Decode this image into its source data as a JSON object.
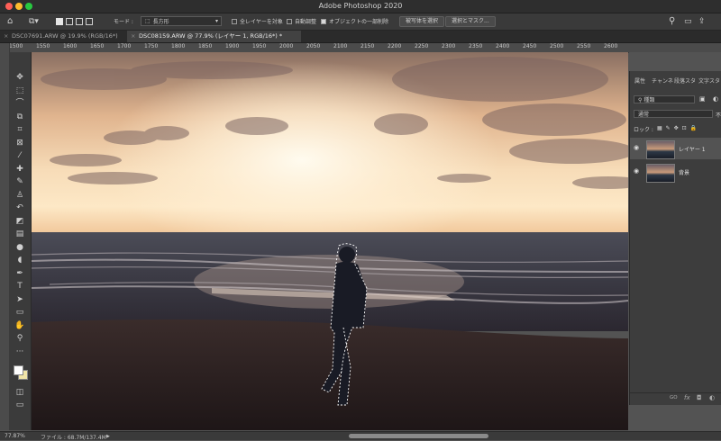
{
  "app": {
    "title": "Adobe Photoshop 2020"
  },
  "options_bar": {
    "mode_label": "モード :",
    "selection_mode": "長方形",
    "sample_all_layers": "全レイヤーを対象",
    "auto_enhance": "自動調整",
    "object_subtract": "オブジェクトの一部削除",
    "select_subject_button": "被写体を選択",
    "select_and_mask_button": "選択とマスク..."
  },
  "tabs": [
    {
      "label": "DSC07691.ARW @ 19.9% (RGB/16*)"
    },
    {
      "label": "DSC08159.ARW @ 77.9% (レイヤー 1, RGB/16*) *"
    }
  ],
  "ruler": {
    "ticks": [
      "1500",
      "1550",
      "1600",
      "1650",
      "1700",
      "1750",
      "1800",
      "1850",
      "1900",
      "1950",
      "2000",
      "2050",
      "2100",
      "2150",
      "2200",
      "2250",
      "2300",
      "2350",
      "2400",
      "2450",
      "2500",
      "2550",
      "2600"
    ]
  },
  "tools": [
    {
      "name": "move-tool",
      "glyph": "✥"
    },
    {
      "name": "marquee-tool",
      "glyph": "⬚"
    },
    {
      "name": "lasso-tool",
      "glyph": "⌒"
    },
    {
      "name": "object-select-tool",
      "glyph": "⧉"
    },
    {
      "name": "crop-tool",
      "glyph": "⌗"
    },
    {
      "name": "frame-tool",
      "glyph": "⊠"
    },
    {
      "name": "eyedropper-tool",
      "glyph": "⁄"
    },
    {
      "name": "healing-brush-tool",
      "glyph": "✚"
    },
    {
      "name": "brush-tool",
      "glyph": "✎"
    },
    {
      "name": "clone-stamp-tool",
      "glyph": "♙"
    },
    {
      "name": "history-brush-tool",
      "glyph": "↶"
    },
    {
      "name": "eraser-tool",
      "glyph": "◩"
    },
    {
      "name": "gradient-tool",
      "glyph": "▤"
    },
    {
      "name": "blur-tool",
      "glyph": "●"
    },
    {
      "name": "dodge-tool",
      "glyph": "◖"
    },
    {
      "name": "pen-tool",
      "glyph": "✒"
    },
    {
      "name": "type-tool",
      "glyph": "T"
    },
    {
      "name": "path-select-tool",
      "glyph": "➤"
    },
    {
      "name": "rectangle-tool",
      "glyph": "▭"
    },
    {
      "name": "hand-tool",
      "glyph": "✋"
    },
    {
      "name": "zoom-tool",
      "glyph": "⚲"
    },
    {
      "name": "more-tools",
      "glyph": "···"
    }
  ],
  "colors": {
    "foreground": "#ffffff",
    "background": "#f0e4a8",
    "accent": "#d8d8d8"
  },
  "layers_panel": {
    "tabs": [
      "属性",
      "チャンネ",
      "段落スタ",
      "文字スタ"
    ],
    "filter_kind": "種類",
    "blend_mode": "通常",
    "opacity_label": "不",
    "lock_label": "ロック :",
    "layers": [
      {
        "name": "レイヤー 1",
        "visible": true,
        "selected": true
      },
      {
        "name": "背景",
        "visible": true,
        "selected": false
      }
    ],
    "footer_icons": [
      "link-icon",
      "fx-icon",
      "mask-icon",
      "adjustment-icon"
    ],
    "footer_labels": {
      "link": "GO",
      "fx": "fx"
    }
  },
  "status": {
    "zoom": "77.87%",
    "file_info": "ファイル : 68.7M/137.4M"
  }
}
